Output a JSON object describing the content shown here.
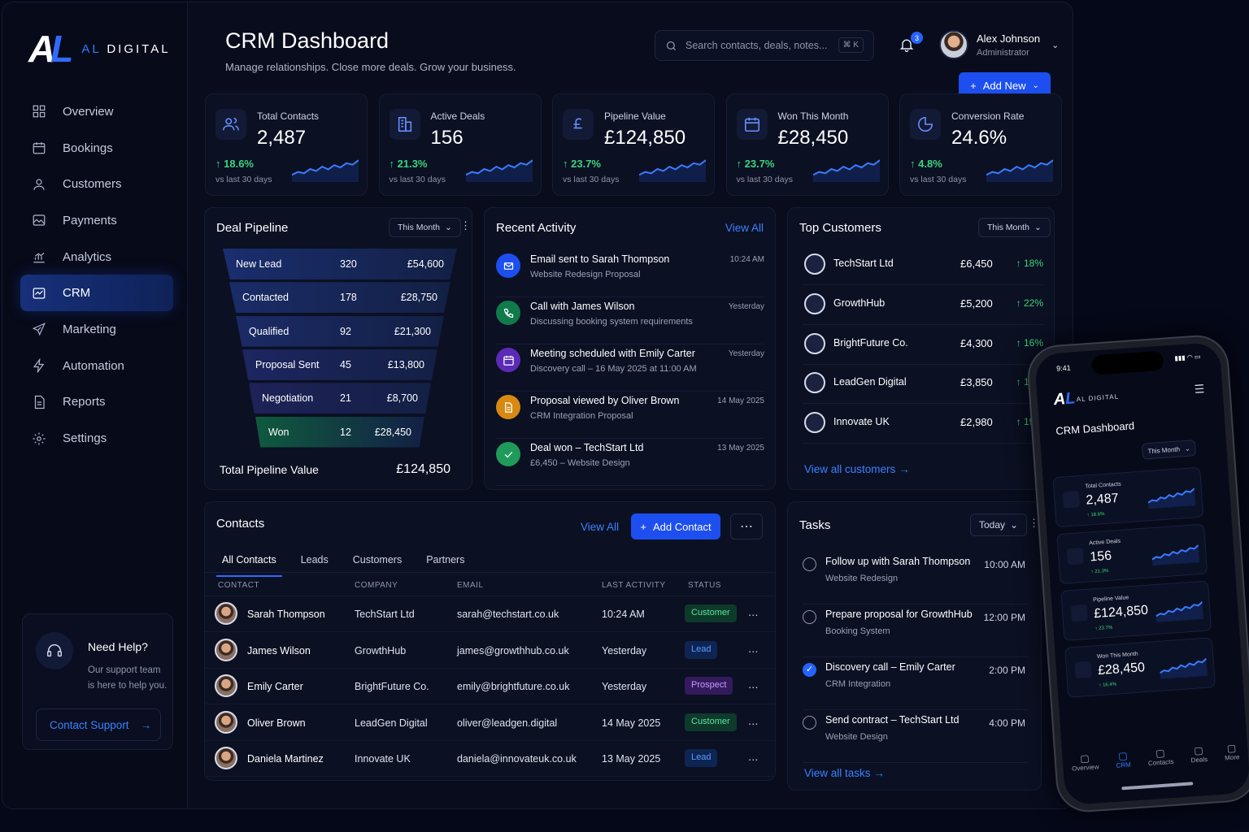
{
  "brand": {
    "logo": "AL",
    "name_a": "AL",
    "name_b": "DIGITAL"
  },
  "nav": [
    {
      "label": "Overview",
      "icon": "grid-icon"
    },
    {
      "label": "Bookings",
      "icon": "calendar-icon"
    },
    {
      "label": "Customers",
      "icon": "user-icon"
    },
    {
      "label": "Payments",
      "icon": "image-icon"
    },
    {
      "label": "Analytics",
      "icon": "chart-icon"
    },
    {
      "label": "CRM",
      "icon": "crm-icon",
      "active": true
    },
    {
      "label": "Marketing",
      "icon": "send-icon"
    },
    {
      "label": "Automation",
      "icon": "bolt-icon"
    },
    {
      "label": "Reports",
      "icon": "report-icon"
    },
    {
      "label": "Settings",
      "icon": "gear-icon"
    }
  ],
  "help": {
    "title": "Need Help?",
    "text": "Our support team is here to help you.",
    "button": "Contact Support"
  },
  "header": {
    "title": "CRM Dashboard",
    "subtitle": "Manage relationships. Close more deals. Grow your business.",
    "search_placeholder": "Search contacts, deals, notes...",
    "shortcut": "⌘ K",
    "notifications": "3",
    "user_name": "Alex Johnson",
    "user_role": "Administrator",
    "add_new": "Add New"
  },
  "kpis": [
    {
      "label": "Total Contacts",
      "value": "2,487",
      "change": "18.6%",
      "vs": "vs last 30 days",
      "icon": "users-icon"
    },
    {
      "label": "Active Deals",
      "value": "156",
      "change": "21.3%",
      "vs": "vs last 30 days",
      "icon": "building-icon"
    },
    {
      "label": "Pipeline Value",
      "value": "£124,850",
      "change": "23.7%",
      "vs": "vs last 30 days",
      "icon": "pound-icon"
    },
    {
      "label": "Won This Month",
      "value": "£28,450",
      "change": "23.7%",
      "vs": "vs last 30 days",
      "icon": "calendar-icon"
    },
    {
      "label": "Conversion Rate",
      "value": "24.6%",
      "change": "4.8%",
      "vs": "vs last 30 days",
      "icon": "pie-icon"
    }
  ],
  "pipeline": {
    "title": "Deal Pipeline",
    "filter": "This Month",
    "stages": [
      {
        "name": "New Lead",
        "count": "320",
        "value": "£54,600"
      },
      {
        "name": "Contacted",
        "count": "178",
        "value": "£28,750"
      },
      {
        "name": "Qualified",
        "count": "92",
        "value": "£21,300"
      },
      {
        "name": "Proposal Sent",
        "count": "45",
        "value": "£13,800"
      },
      {
        "name": "Negotiation",
        "count": "21",
        "value": "£8,700"
      },
      {
        "name": "Won",
        "count": "12",
        "value": "£28,450"
      }
    ],
    "total_label": "Total Pipeline Value",
    "total": "£124,850"
  },
  "activity": {
    "title": "Recent Activity",
    "view_all": "View All",
    "items": [
      {
        "title": "Email sent to Sarah Thompson",
        "sub": "Website Redesign Proposal",
        "time": "10:24 AM",
        "color": "#1d4ff0",
        "icon": "mail-icon"
      },
      {
        "title": "Call with James Wilson",
        "sub": "Discussing booking system requirements",
        "time": "Yesterday",
        "color": "#0f7a4a",
        "icon": "phone-icon"
      },
      {
        "title": "Meeting scheduled with Emily Carter",
        "sub": "Discovery call – 16 May 2025 at 11:00 AM",
        "time": "Yesterday",
        "color": "#5b2bb5",
        "icon": "calendar-icon"
      },
      {
        "title": "Proposal viewed by Oliver Brown",
        "sub": "CRM Integration Proposal",
        "time": "14 May 2025",
        "color": "#d68a12",
        "icon": "document-icon"
      },
      {
        "title": "Deal won – TechStart Ltd",
        "sub": "£6,450 – Website Design",
        "time": "13 May 2025",
        "color": "#1f9a5a",
        "icon": "check-icon"
      }
    ]
  },
  "top_customers": {
    "title": "Top Customers",
    "filter": "This Month",
    "items": [
      {
        "name": "TechStart Ltd",
        "amount": "£6,450",
        "change": "18%"
      },
      {
        "name": "GrowthHub",
        "amount": "£5,200",
        "change": "22%"
      },
      {
        "name": "BrightFuture Co.",
        "amount": "£4,300",
        "change": "16%"
      },
      {
        "name": "LeadGen Digital",
        "amount": "£3,850",
        "change": "12%"
      },
      {
        "name": "Innovate UK",
        "amount": "£2,980",
        "change": "19%"
      }
    ],
    "view_all": "View all customers"
  },
  "contacts": {
    "title": "Contacts",
    "view_all": "View All",
    "add": "Add Contact",
    "tabs": [
      "All Contacts",
      "Leads",
      "Customers",
      "Partners"
    ],
    "columns": [
      "CONTACT",
      "COMPANY",
      "EMAIL",
      "LAST ACTIVITY",
      "STATUS"
    ],
    "rows": [
      {
        "name": "Sarah Thompson",
        "company": "TechStart Ltd",
        "email": "sarah@techstart.co.uk",
        "last": "10:24 AM",
        "status": "Customer"
      },
      {
        "name": "James Wilson",
        "company": "GrowthHub",
        "email": "james@growthhub.co.uk",
        "last": "Yesterday",
        "status": "Lead"
      },
      {
        "name": "Emily Carter",
        "company": "BrightFuture Co.",
        "email": "emily@brightfuture.co.uk",
        "last": "Yesterday",
        "status": "Prospect"
      },
      {
        "name": "Oliver Brown",
        "company": "LeadGen Digital",
        "email": "oliver@leadgen.digital",
        "last": "14 May 2025",
        "status": "Customer"
      },
      {
        "name": "Daniela Martinez",
        "company": "Innovate UK",
        "email": "daniela@innovateuk.co.uk",
        "last": "13 May 2025",
        "status": "Lead"
      }
    ]
  },
  "tasks": {
    "title": "Tasks",
    "filter": "Today",
    "items": [
      {
        "title": "Follow up with Sarah Thompson",
        "sub": "Website Redesign",
        "time": "10:00 AM",
        "done": false
      },
      {
        "title": "Prepare proposal for GrowthHub",
        "sub": "Booking System",
        "time": "12:00 PM",
        "done": false
      },
      {
        "title": "Discovery call – Emily Carter",
        "sub": "CRM Integration",
        "time": "2:00 PM",
        "done": true
      },
      {
        "title": "Send contract – TechStart Ltd",
        "sub": "Website Design",
        "time": "4:00 PM",
        "done": false
      }
    ],
    "view_all": "View all tasks"
  },
  "phone": {
    "time": "9:41",
    "brand": "AL DIGITAL",
    "title": "CRM Dashboard",
    "filter": "This Month",
    "cards": [
      {
        "label": "Total Contacts",
        "value": "2,487",
        "change": "18.6%"
      },
      {
        "label": "Active Deals",
        "value": "156",
        "change": "21.3%"
      },
      {
        "label": "Pipeline Value",
        "value": "£124,850",
        "change": "23.7%"
      },
      {
        "label": "Won This Month",
        "value": "£28,450",
        "change": "16.4%"
      }
    ],
    "nav": [
      "Overview",
      "CRM",
      "Contacts",
      "Deals",
      "More"
    ]
  }
}
